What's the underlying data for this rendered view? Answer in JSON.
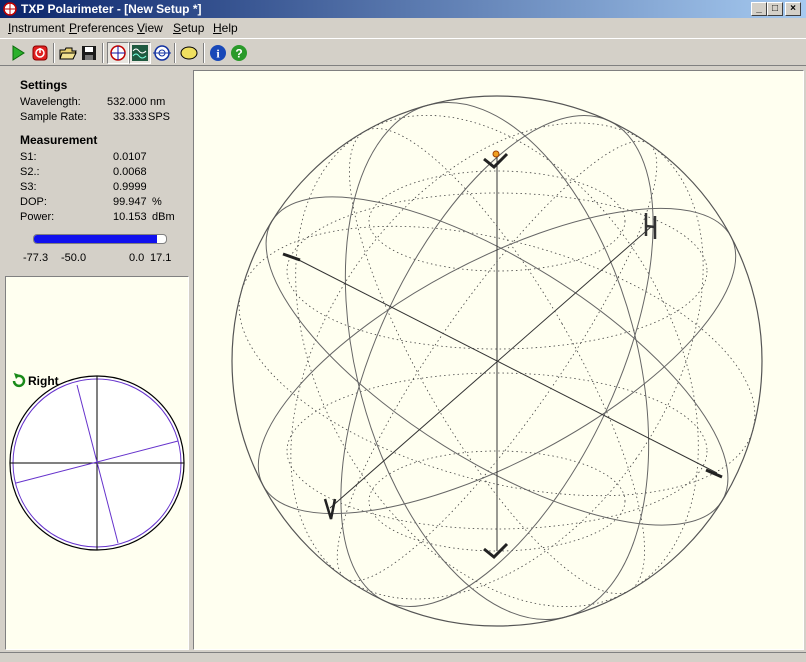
{
  "window": {
    "title": "TXP Polarimeter - [New Setup *]"
  },
  "menu": [
    {
      "label": "Instrument",
      "mnemonic": "I",
      "rest": "nstrument"
    },
    {
      "label": "Preferences",
      "mnemonic": "P",
      "rest": "references"
    },
    {
      "label": "View",
      "mnemonic": "V",
      "rest": "iew"
    },
    {
      "label": "Setup",
      "mnemonic": "S",
      "rest": "etup"
    },
    {
      "label": "Help",
      "mnemonic": "H",
      "rest": "elp"
    }
  ],
  "toolbar": {
    "buttons": [
      "play-icon",
      "stop-icon",
      "open-icon",
      "save-icon",
      "sphere-view-icon",
      "chart-view-icon",
      "target-view-icon",
      "ellipse-icon",
      "info-icon",
      "help-icon"
    ]
  },
  "settings": {
    "heading": "Settings",
    "wavelength_label": "Wavelength:",
    "wavelength_value": "532.000",
    "wavelength_unit": "nm",
    "sample_rate_label": "Sample Rate:",
    "sample_rate_value": "33.333",
    "sample_rate_unit": "SPS"
  },
  "measurement": {
    "heading": "Measurement",
    "s1_label": "S1:",
    "s1_value": "0.0107",
    "s2_label": "S2.:",
    "s2_value": "0.0068",
    "s3_label": "S3:",
    "s3_value": "0.9999",
    "dop_label": "DOP:",
    "dop_value": "99.947",
    "dop_unit": "%",
    "power_label": "Power:",
    "power_value": "10.153",
    "power_unit": "dBm"
  },
  "power_bar": {
    "fill_fraction": 0.93,
    "fill_color": "#1010ee",
    "scale_labels": [
      "-77.3",
      "-50.0",
      "0.0",
      "17.1"
    ]
  },
  "ellipse_view": {
    "handedness": "Right",
    "line_color": "#6633cc"
  },
  "sphere": {
    "labels": [
      "H",
      "V"
    ]
  }
}
